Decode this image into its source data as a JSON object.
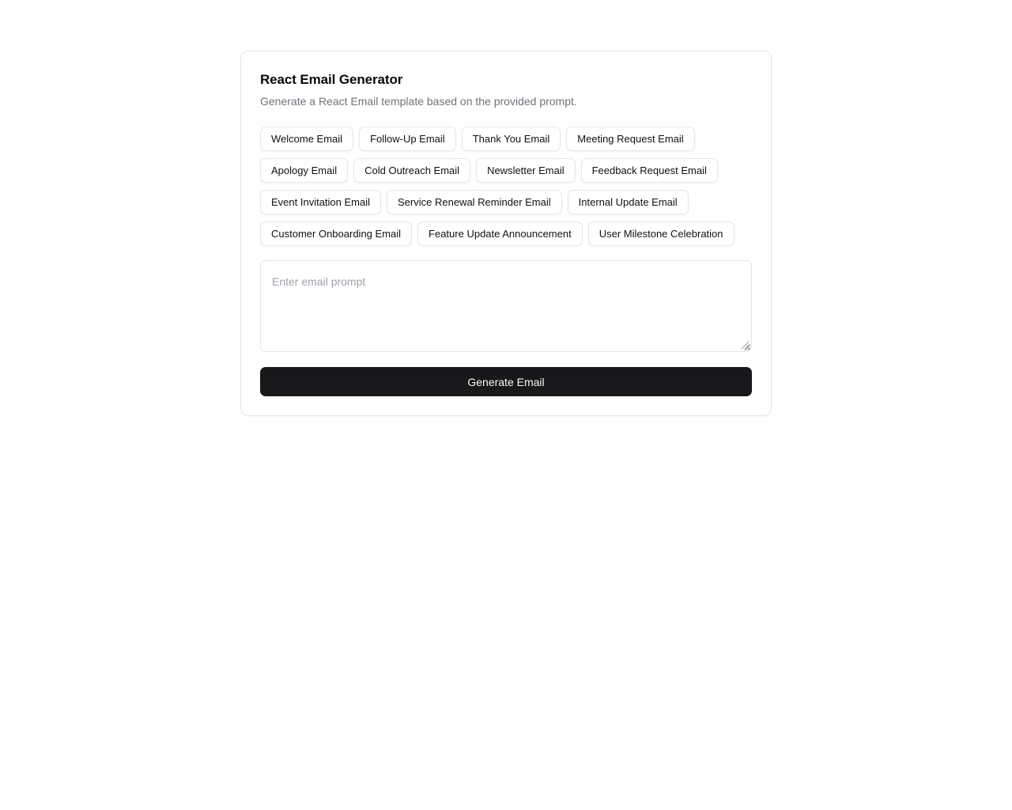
{
  "card": {
    "title": "React Email Generator",
    "subtitle": "Generate a React Email template based on the provided prompt.",
    "chips": [
      {
        "label": "Welcome Email"
      },
      {
        "label": "Follow-Up Email"
      },
      {
        "label": "Thank You Email"
      },
      {
        "label": "Meeting Request Email"
      },
      {
        "label": "Apology Email"
      },
      {
        "label": "Cold Outreach Email"
      },
      {
        "label": "Newsletter Email"
      },
      {
        "label": "Feedback Request Email"
      },
      {
        "label": "Event Invitation Email"
      },
      {
        "label": "Service Renewal Reminder Email"
      },
      {
        "label": "Internal Update Email"
      },
      {
        "label": "Customer Onboarding Email"
      },
      {
        "label": "Feature Update Announcement"
      },
      {
        "label": "User Milestone Celebration"
      }
    ],
    "prompt": {
      "placeholder": "Enter email prompt",
      "value": "",
      "resize_handle_icon": "resize-grip-icon"
    },
    "submit": {
      "label": "Generate Email"
    }
  },
  "colors": {
    "page_background": "#ffffff",
    "card_border": "#e5e7eb",
    "title_text": "#09090b",
    "subtitle_text": "#71717a",
    "chip_border": "#e6e7ea",
    "chip_text": "#111113",
    "placeholder_text": "#a1a1aa",
    "button_background": "#18181b",
    "button_text": "#fafafa"
  }
}
